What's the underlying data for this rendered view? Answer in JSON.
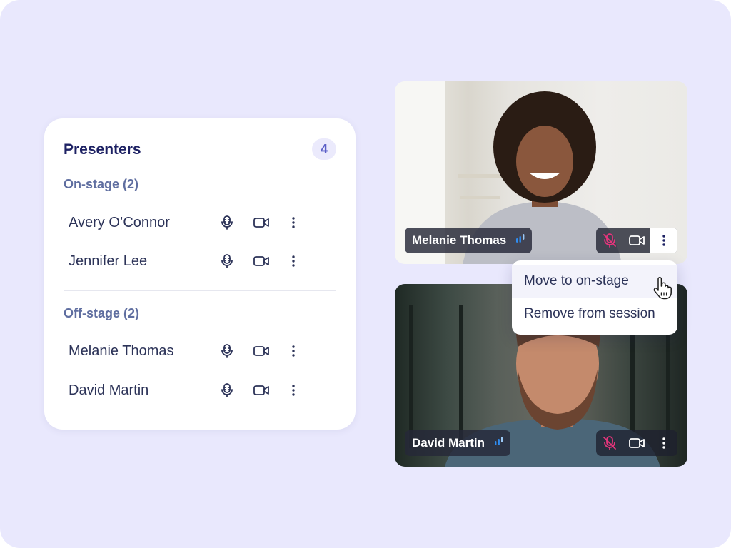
{
  "panel": {
    "title": "Presenters",
    "count": "4",
    "sections": [
      {
        "label": "On-stage (2)",
        "people": [
          "Avery O’Connor",
          "Jennifer Lee"
        ]
      },
      {
        "label": "Off-stage (2)",
        "people": [
          "Melanie Thomas",
          "David Martin"
        ]
      }
    ],
    "row_icons": [
      "mic-icon",
      "camera-icon",
      "more-vertical-icon"
    ]
  },
  "tiles": [
    {
      "name": "Melanie Thomas",
      "mic_muted": true
    },
    {
      "name": "David Martin",
      "mic_muted": true
    }
  ],
  "menu": {
    "items": [
      "Move to on-stage",
      "Remove from session"
    ]
  },
  "colors": {
    "background": "#e9e8fd",
    "title": "#1d2163",
    "section": "#5f6ea0",
    "accent": "#5b5fc7",
    "muted_mic": "#e5357c",
    "speaking": "#2f8cf0"
  }
}
